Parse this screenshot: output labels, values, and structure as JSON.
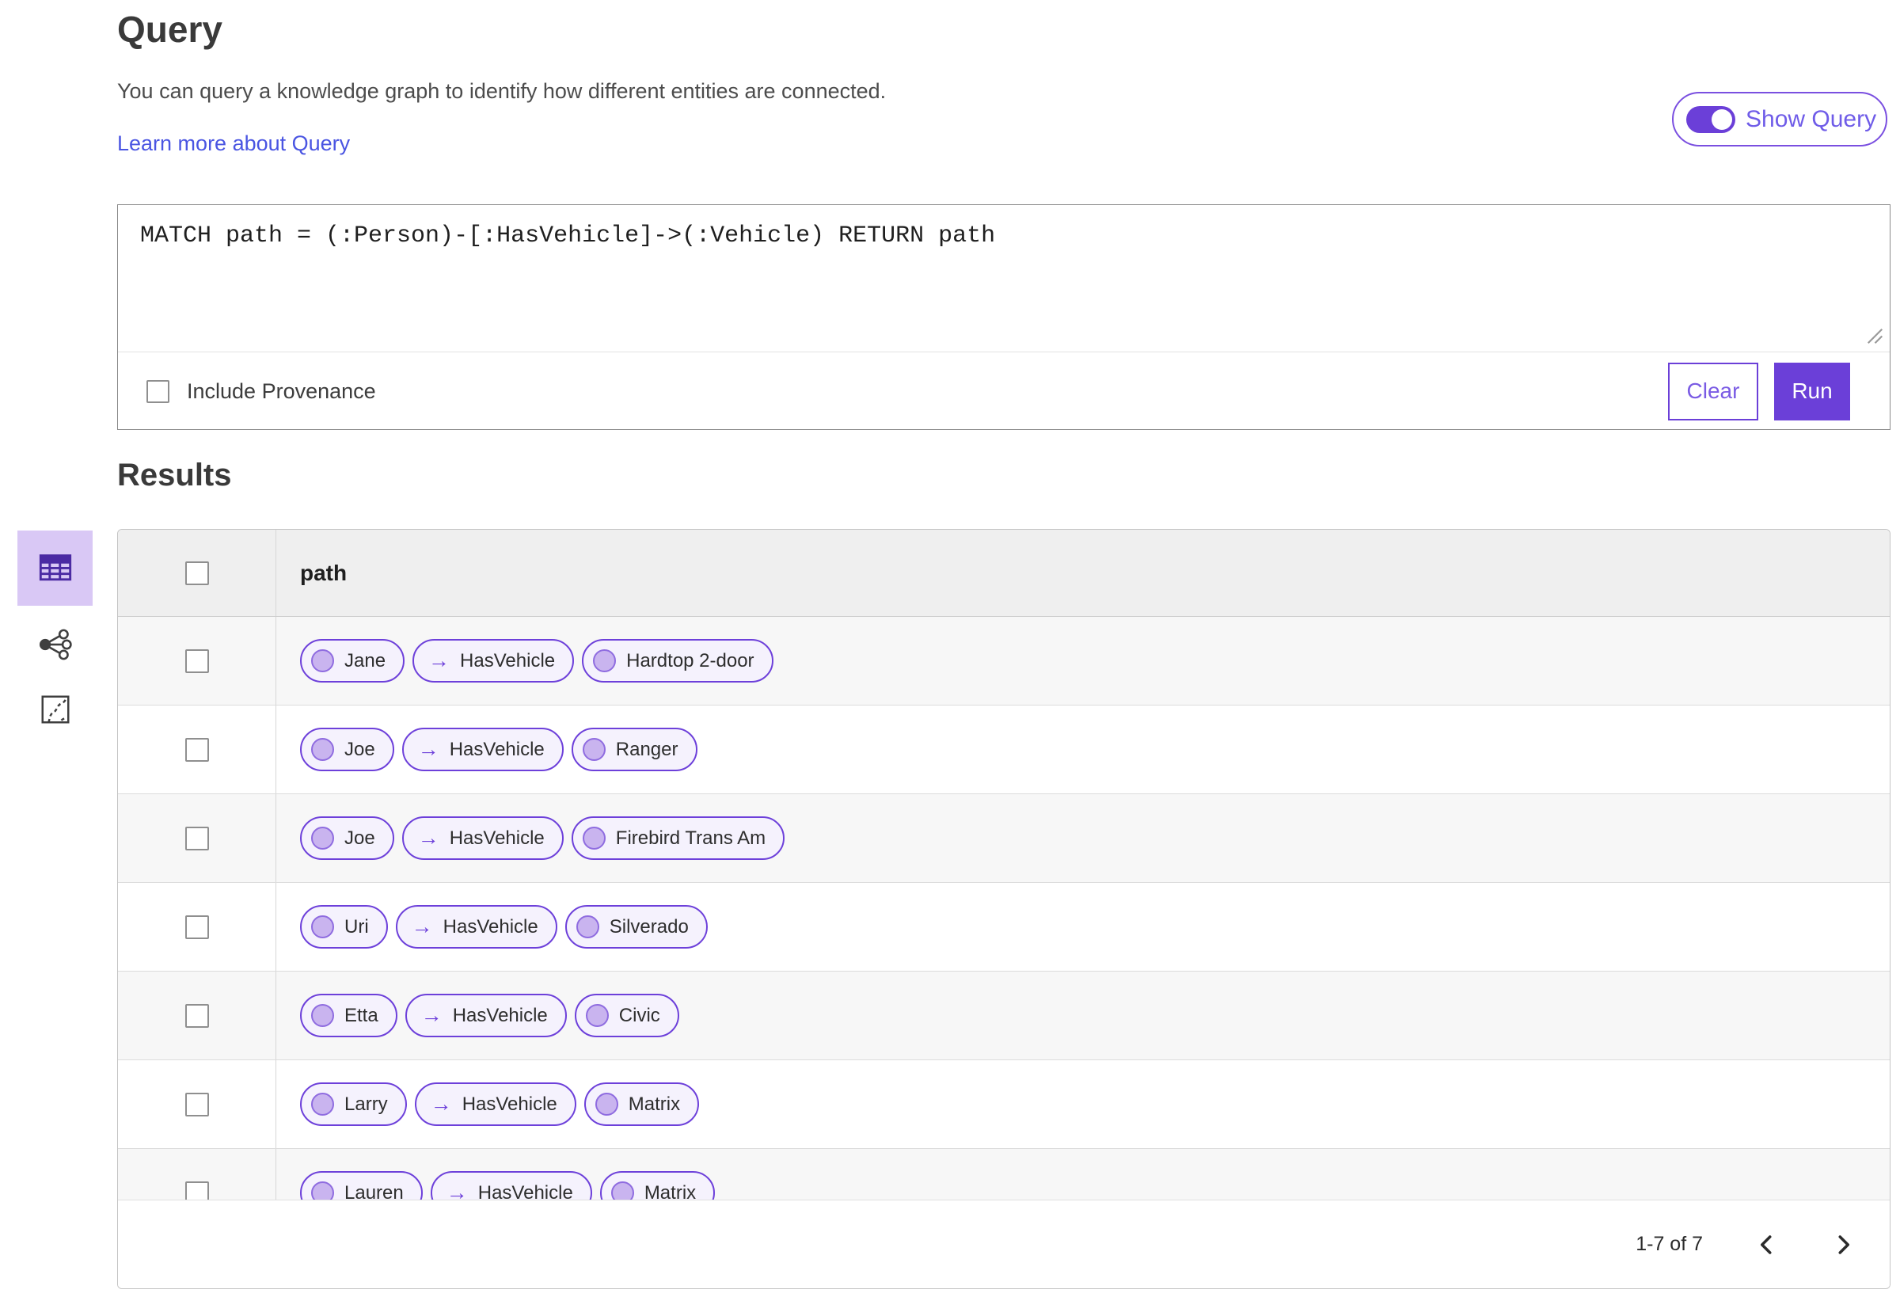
{
  "colors": {
    "accent": "#6b3fd8",
    "accent_light": "#7a5be4",
    "toggle_label": "#6f5ce8",
    "link": "#4a55e2",
    "selected_view_bg": "#d9c8f5",
    "selected_view_icon": "#4b2aa3",
    "pill_bg": "#f5f2fd",
    "pill_border": "#6d40da",
    "node_fill": "#c9b4ef",
    "node_border": "#8f6ce0",
    "table_header_bg": "#efefef",
    "row_alt_bg": "#f7f7f7"
  },
  "query_section": {
    "title": "Query",
    "description": "You can query a knowledge graph to identify how different entities are connected.",
    "learn_more_label": "Learn more about Query",
    "show_query_label": "Show Query",
    "show_query_on": true,
    "query_text": "MATCH path = (:Person)-[:HasVehicle]->(:Vehicle) RETURN path",
    "include_provenance_label": "Include Provenance",
    "include_provenance_checked": false,
    "clear_label": "Clear",
    "run_label": "Run"
  },
  "results_section": {
    "title": "Results",
    "views": [
      {
        "name": "table-view",
        "selected": true
      },
      {
        "name": "link-chart-view",
        "selected": false
      },
      {
        "name": "map-view",
        "selected": false
      }
    ],
    "table": {
      "column_header": "path",
      "arrow_glyph": "→",
      "rows": [
        {
          "entity": "Jane",
          "relationship": "HasVehicle",
          "target": "Hardtop 2-door"
        },
        {
          "entity": "Joe",
          "relationship": "HasVehicle",
          "target": "Ranger"
        },
        {
          "entity": "Joe",
          "relationship": "HasVehicle",
          "target": "Firebird Trans Am"
        },
        {
          "entity": "Uri",
          "relationship": "HasVehicle",
          "target": "Silverado"
        },
        {
          "entity": "Etta",
          "relationship": "HasVehicle",
          "target": "Civic"
        },
        {
          "entity": "Larry",
          "relationship": "HasVehicle",
          "target": "Matrix"
        },
        {
          "entity": "Lauren",
          "relationship": "HasVehicle",
          "target": "Matrix"
        }
      ]
    },
    "pagination": {
      "range_label": "1-7 of 7"
    }
  }
}
